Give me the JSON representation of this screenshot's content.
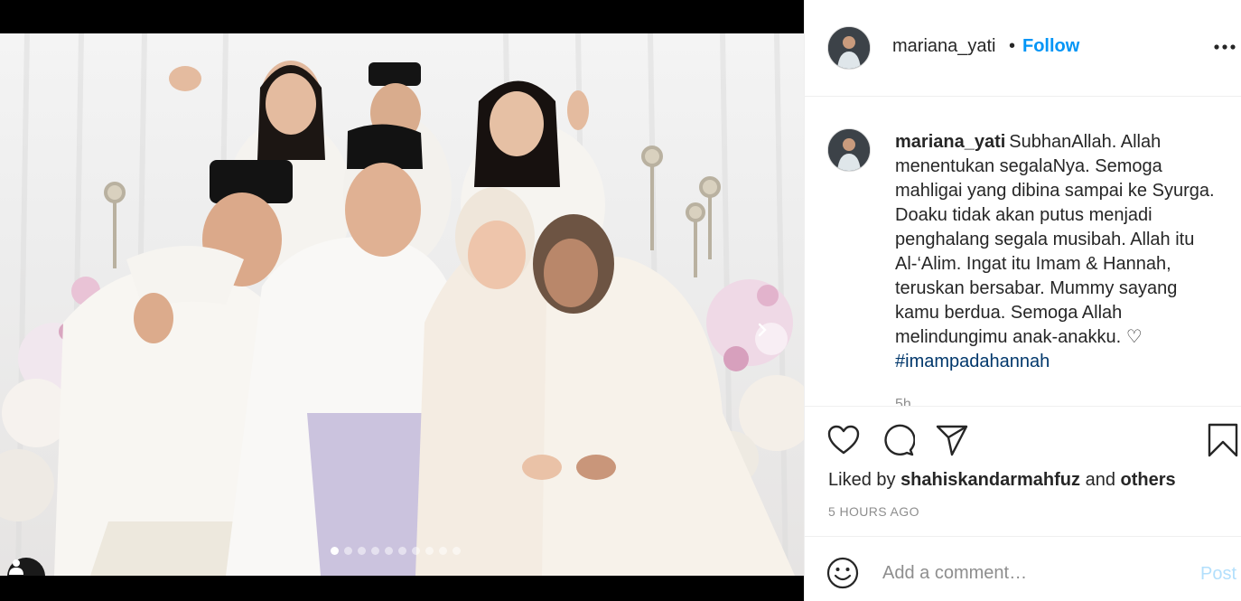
{
  "post": {
    "username": "mariana_yati",
    "separator": "•",
    "follow_label": "Follow",
    "more_icon": "more-horizontal-icon"
  },
  "media": {
    "carousel_total": 10,
    "carousel_active": 0,
    "next_icon": "chevron-right-icon",
    "tag_icon": "user-tag-icon",
    "colors": {
      "background": "#000000",
      "robe": "#f7f5f2",
      "songkok": "#111111",
      "sarong": "#c9c2de"
    }
  },
  "caption": {
    "username": "mariana_yati",
    "text": "SubhanAllah. Allah menentukan segalaNya. Semoga mahligai yang dibina sampai ke Syurga. Doaku tidak akan putus menjadi penghalang segala musibah. Allah itu Al-‘Alim. Ingat itu Imam & Hannah, teruskan bersabar. Mummy sayang kamu berdua. Semoga Allah melindungimu anak-anakku. ♡",
    "hashtag": "#imampadahannah",
    "time_peek": "5h"
  },
  "actions": {
    "like_icon": "heart-icon",
    "comment_icon": "comment-icon",
    "share_icon": "share-icon",
    "save_icon": "bookmark-icon"
  },
  "likes": {
    "prefix": "Liked by",
    "user": "shahiskandarmahfuz",
    "middle": "and",
    "others": "others"
  },
  "timestamp": "5 HOURS AGO",
  "comment": {
    "placeholder": "Add a comment…",
    "post_label": "Post",
    "emoji_icon": "emoji-icon"
  },
  "colors": {
    "accent": "#0095f6",
    "hashtag": "#00376b",
    "muted": "#8e8e8e",
    "post_disabled": "#b2dffc"
  }
}
